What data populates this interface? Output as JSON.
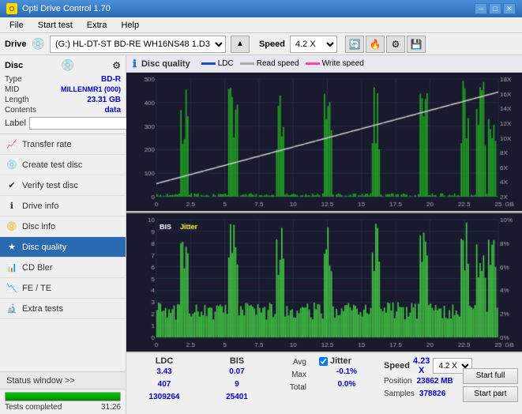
{
  "titleBar": {
    "title": "Opti Drive Control 1.70",
    "minBtn": "─",
    "maxBtn": "□",
    "closeBtn": "✕"
  },
  "menuBar": {
    "items": [
      "File",
      "Start test",
      "Extra",
      "Help"
    ]
  },
  "driveBar": {
    "label": "Drive",
    "driveValue": "(G:)  HL-DT-ST BD-RE  WH16NS48 1.D3",
    "speedLabel": "Speed",
    "speedValue": "4.2 X"
  },
  "disc": {
    "title": "Disc",
    "typeLabel": "Type",
    "typeValue": "BD-R",
    "midLabel": "MID",
    "midValue": "MILLENMR1 (000)",
    "lengthLabel": "Length",
    "lengthValue": "23.31 GB",
    "contentsLabel": "Contents",
    "contentsValue": "data",
    "labelLabel": "Label",
    "labelValue": ""
  },
  "nav": {
    "items": [
      {
        "id": "transfer-rate",
        "label": "Transfer rate",
        "icon": "📈"
      },
      {
        "id": "create-test-disc",
        "label": "Create test disc",
        "icon": "💿"
      },
      {
        "id": "verify-test-disc",
        "label": "Verify test disc",
        "icon": "✔"
      },
      {
        "id": "drive-info",
        "label": "Drive info",
        "icon": "ℹ"
      },
      {
        "id": "disc-info",
        "label": "Disc info",
        "icon": "📀"
      },
      {
        "id": "disc-quality",
        "label": "Disc quality",
        "icon": "★",
        "active": true
      },
      {
        "id": "cd-bler",
        "label": "CD Bler",
        "icon": "📊"
      },
      {
        "id": "fe-te",
        "label": "FE / TE",
        "icon": "📉"
      },
      {
        "id": "extra-tests",
        "label": "Extra tests",
        "icon": "🔬"
      }
    ]
  },
  "statusWindow": {
    "label": "Status window >>",
    "chevrons": ">>"
  },
  "progress": {
    "percent": 100,
    "statusText": "Tests completed",
    "timeText": "31:26"
  },
  "chart": {
    "title": "Disc quality",
    "legend": {
      "ldcLabel": "LDC",
      "readSpeedLabel": "Read speed",
      "writeSpeedLabel": "Write speed",
      "bisLabel": "BIS",
      "jitterLabel": "Jitter"
    }
  },
  "stats": {
    "headers": [
      "",
      "LDC",
      "BIS",
      "",
      "Jitter",
      "",
      "Speed",
      ""
    ],
    "avgLabel": "Avg",
    "maxLabel": "Max",
    "totalLabel": "Total",
    "ldcAvg": "3.43",
    "ldcMax": "407",
    "ldcTotal": "1309264",
    "bisAvg": "0.07",
    "bisMax": "9",
    "bisTotal": "25401",
    "jitterAvg": "-0.1%",
    "jitterMax": "0.0%",
    "jitterChecked": true,
    "speedVal": "4.23 X",
    "positionLabel": "Position",
    "positionVal": "23862 MB",
    "samplesLabel": "Samples",
    "samplesVal": "378826",
    "startFullLabel": "Start full",
    "startPartLabel": "Start part",
    "speedDropdownVal": "4.2 X"
  }
}
